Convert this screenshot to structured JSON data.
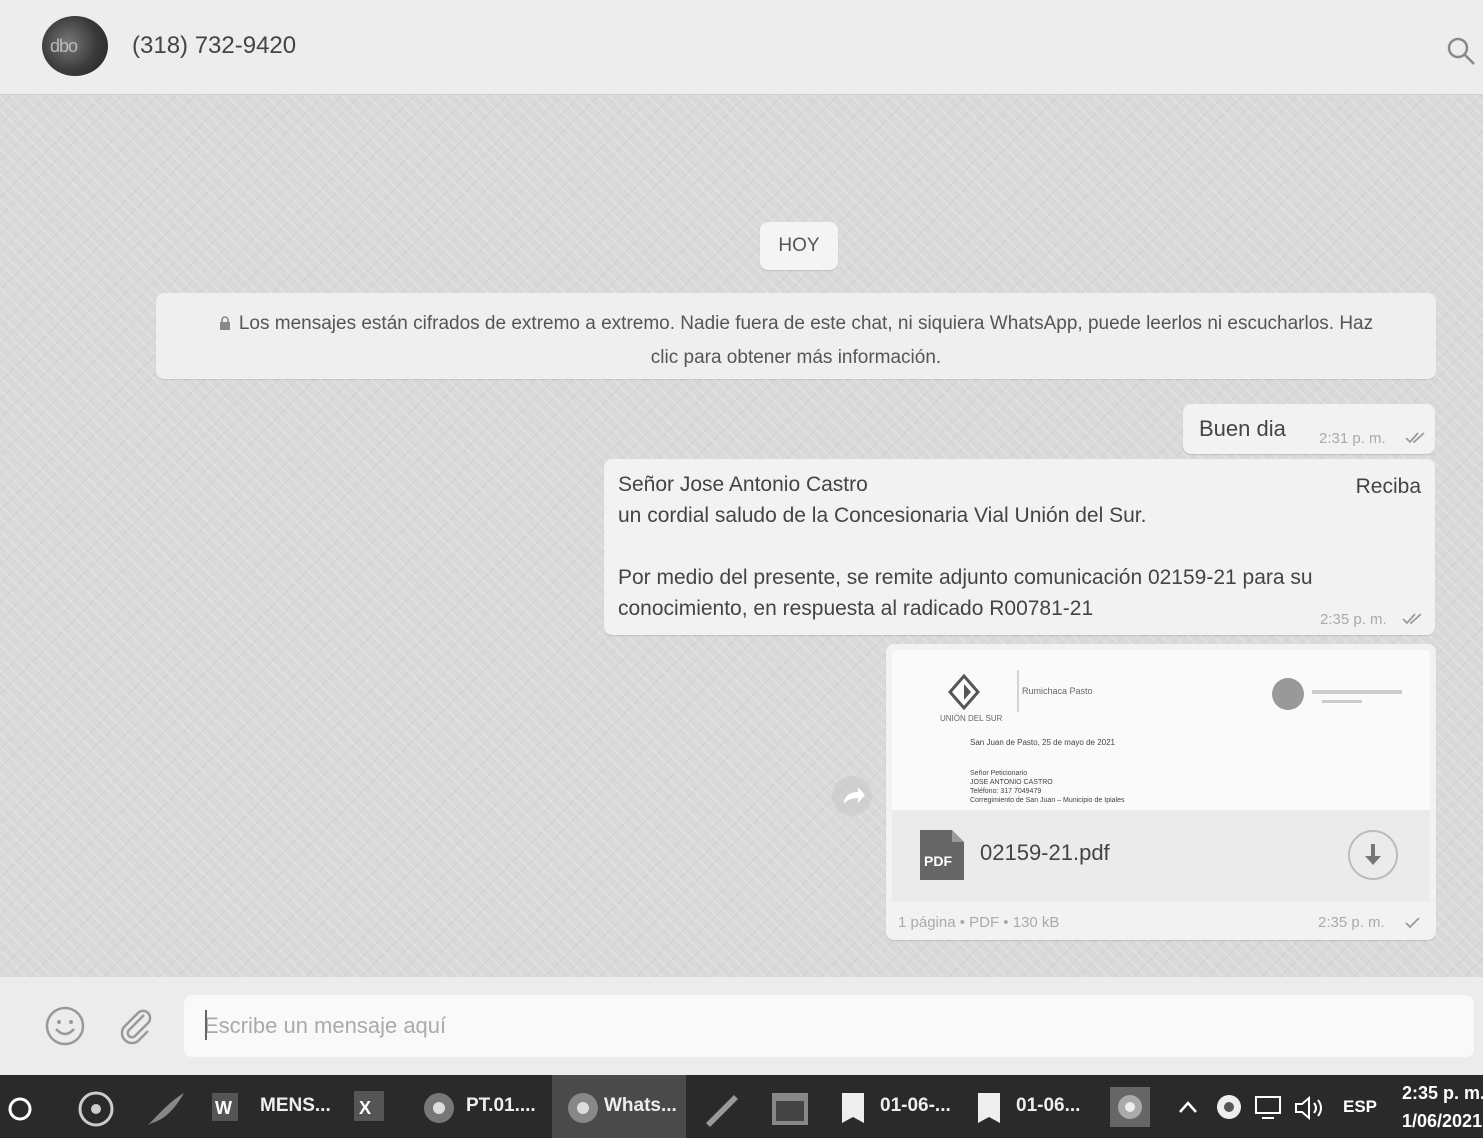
{
  "header": {
    "contact_name": "(318) 732-9420",
    "avatar_text": "dbo"
  },
  "chat": {
    "day_label": "HOY",
    "encryption_notice_line1": "Los mensajes están cifrados de extremo a extremo. Nadie fuera de este chat, ni siquiera WhatsApp, puede leerlos ni escucharlos. Haz",
    "encryption_notice_line2": "clic para obtener más información.",
    "messages": [
      {
        "text": "Buen dia",
        "time": "2:31 p. m.",
        "status": "read"
      },
      {
        "line1": "Señor Jose Antonio Castro",
        "line1_right": "Reciba",
        "line2": "un cordial saludo de la Concesionaria Vial Unión del Sur.",
        "line3": "Por medio del presente, se remite adjunto comunicación 02159-21  para su",
        "line4": "conocimiento, en respuesta al radicado  R00781-21",
        "time": "2:35 p. m.",
        "status": "read"
      },
      {
        "file_name": "02159-21.pdf",
        "file_meta": "1 página • PDF • 130 kB",
        "time": "2:35 p. m.",
        "status": "sent",
        "preview": {
          "logo_left_caption": "UNIÓN DEL SUR",
          "logo_mid_text": "Rumichaca Pasto",
          "date_line": "San Juan de Pasto, 25 de mayo de 2021",
          "addr_line1": "Señor Peticionario",
          "addr_line2": "JOSE ANTONIO CASTRO",
          "addr_line3": "Teléfono: 317 7049479",
          "addr_line4": "Corregimiento de San Juan – Municipio de Ipiales"
        }
      }
    ]
  },
  "composer": {
    "placeholder": "Escribe un mensaje aquí"
  },
  "taskbar": {
    "items": [
      {
        "label": "MENS..."
      },
      {
        "label": "PT.01...."
      },
      {
        "label": "Whats..."
      },
      {
        "label": "01-06-..."
      },
      {
        "label": "01-06..."
      }
    ],
    "language": "ESP",
    "clock_time": "2:35 p. m.",
    "clock_date": "1/06/2021"
  }
}
